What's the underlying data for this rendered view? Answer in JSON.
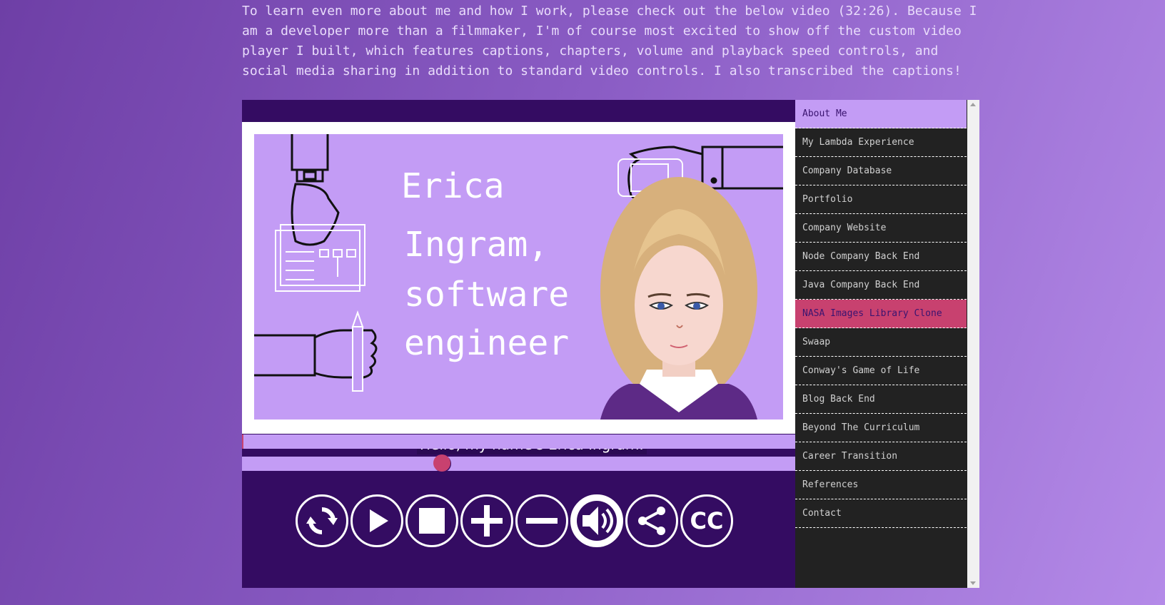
{
  "intro": {
    "text": "To learn even more about me and how I work, please check out the below video (32:26). Because I am a developer more than a filmmaker, I'm of course most excited to show off the custom video player I built, which features captions, chapters, volume and playback speed controls, and social media sharing in addition to standard video controls. I also transcribed the captions!"
  },
  "video": {
    "slide_title_lines": [
      "Erica",
      "Ingram,",
      "software",
      "engineer"
    ],
    "caption": "Hello, my name's Erica Ingram.",
    "progress": 0.0,
    "volume_level": 0.36
  },
  "controls": [
    {
      "icon": "replay-icon",
      "active": false
    },
    {
      "icon": "play-icon",
      "active": false
    },
    {
      "icon": "stop-icon",
      "active": false
    },
    {
      "icon": "plus-icon",
      "active": false
    },
    {
      "icon": "minus-icon",
      "active": false
    },
    {
      "icon": "volume-icon",
      "active": true
    },
    {
      "icon": "share-icon",
      "active": false
    },
    {
      "icon": "cc-icon",
      "label": "CC",
      "active": false
    }
  ],
  "chapters": {
    "items": [
      {
        "label": "About Me",
        "state": "current"
      },
      {
        "label": "My Lambda Experience",
        "state": ""
      },
      {
        "label": "Company Database",
        "state": ""
      },
      {
        "label": "Portfolio",
        "state": ""
      },
      {
        "label": "Company Website",
        "state": ""
      },
      {
        "label": "Node Company Back End",
        "state": ""
      },
      {
        "label": "Java Company Back End",
        "state": ""
      },
      {
        "label": "NASA Images Library Clone",
        "state": "active"
      },
      {
        "label": "Swaap",
        "state": ""
      },
      {
        "label": "Conway's Game of Life",
        "state": ""
      },
      {
        "label": "Blog Back End",
        "state": ""
      },
      {
        "label": "Beyond The Curriculum",
        "state": ""
      },
      {
        "label": "Career Transition",
        "state": ""
      },
      {
        "label": "References",
        "state": ""
      },
      {
        "label": "Contact",
        "state": ""
      }
    ]
  },
  "colors": {
    "player_bg": "#340c62",
    "accent_lavender": "#c39cf5",
    "accent_pink": "#c8416f",
    "chapter_bg": "#222222"
  }
}
